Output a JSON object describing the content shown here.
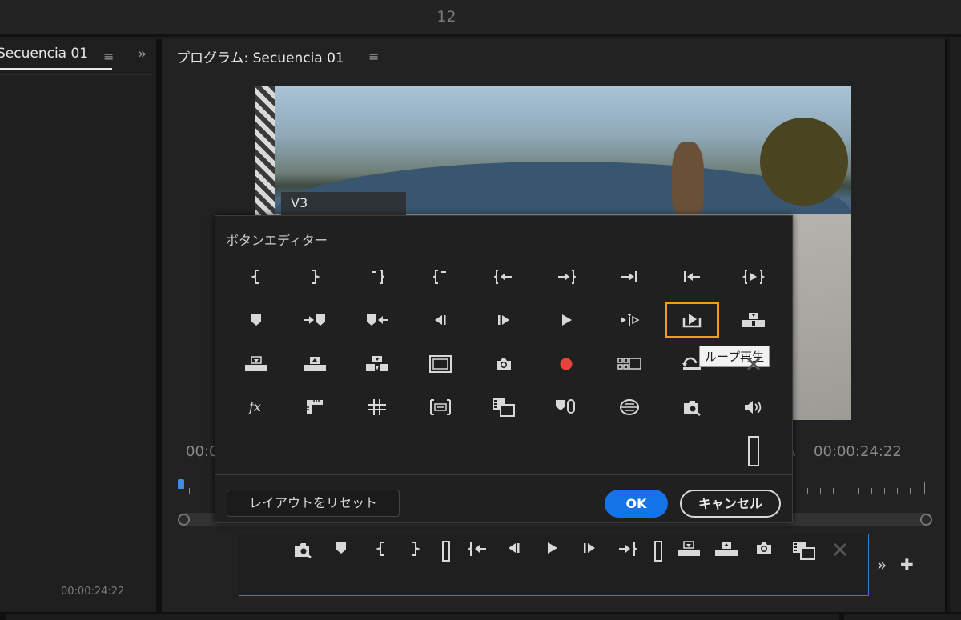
{
  "topbar": {
    "title": "12"
  },
  "left_panel": {
    "tab_label": "Secuencia 01",
    "menu_icon": "≡",
    "chevron": "»",
    "timecode": "00:00:24:22"
  },
  "program": {
    "title": "プログラム: Secuencia 01",
    "menu_icon": "≡",
    "track_label": "V3",
    "timecode_left": "00:0",
    "timecode_right": "00:00:24:22"
  },
  "dialog": {
    "title": "ボタンエディター",
    "tooltip": "ループ再生",
    "reset_label": "レイアウトをリセット",
    "ok_label": "OK",
    "cancel_label": "キャンセル",
    "fx_label": "fx"
  },
  "colors": {
    "accent": "#1473e6",
    "highlight": "#f29b1a",
    "record": "#e8433a",
    "playhead": "#3b8ee8",
    "bar_border": "#2f7fd8"
  },
  "dialog_icons": [
    [
      "mark-in-icon",
      "mark-out-icon",
      "clear-in-icon",
      "clear-out-icon",
      "go-to-in-icon",
      "go-to-out-icon",
      "next-edit-icon",
      "previous-edit-icon",
      "play-in-to-out-icon"
    ],
    [
      "add-marker-icon",
      "next-marker-icon",
      "previous-marker-icon",
      "step-back-icon",
      "step-forward-icon",
      "play-icon",
      "shuttle-icon",
      "loop-playback-icon",
      "overwrite-icon"
    ],
    [
      "lift-icon",
      "extract-icon",
      "insert-icon",
      "safe-margins-icon",
      "export-frame-icon",
      "record-icon",
      "multi-camera-icon",
      "restore-icon",
      "proxy-toggle-icon"
    ],
    [
      "fx-bypass-icon",
      "show-rulers-icon",
      "show-guides-icon",
      "vr-video-icon",
      "comparison-view-icon",
      "marker-link-icon",
      "snap-vr-icon",
      "zoom-fit-icon",
      "volume-icon"
    ]
  ],
  "bar_icons": [
    "zoom-fit-icon",
    "add-marker-icon",
    "mark-in-icon",
    "mark-out-icon",
    "spacer-icon",
    "go-to-in-icon",
    "step-back-icon",
    "play-icon",
    "step-forward-icon",
    "go-to-out-icon",
    "spacer-icon",
    "lift-icon",
    "extract-icon",
    "export-frame-icon",
    "comparison-view-icon",
    "proxy-toggle-icon"
  ]
}
